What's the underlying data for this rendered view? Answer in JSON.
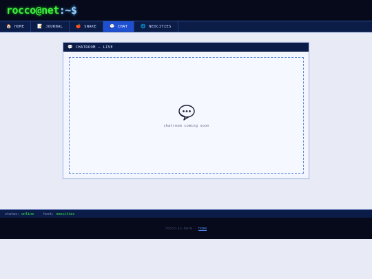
{
  "header": {
    "logo_main": "rocco@net",
    "logo_suffix": ":~$"
  },
  "nav": {
    "items": [
      {
        "icon": "🏠",
        "label": "HOME"
      },
      {
        "icon": "📝",
        "label": "JOURNAL"
      },
      {
        "icon": "🍎",
        "label": "SNAKE"
      },
      {
        "icon": "💬",
        "label": "CHAT"
      },
      {
        "icon": "🌐",
        "label": "NEOCITIES"
      }
    ],
    "active": "CHAT"
  },
  "panel": {
    "icon": "💬",
    "title": "CHATROOM — LIVE",
    "placeholder_text": "chatroom coming soon"
  },
  "status_bar": {
    "status_key": "status:",
    "status_value": "online",
    "host_key": "host:",
    "host_value": "neocities"
  },
  "footer": {
    "text": "rocco-is-here",
    "separator": "·",
    "link_label": "home"
  },
  "colors": {
    "accent_green": "#3df03d",
    "nav_active": "#1e4fd0",
    "dark_bg": "#060a1a",
    "panel_header": "#0c1c48",
    "link_blue": "#5b8cff"
  }
}
